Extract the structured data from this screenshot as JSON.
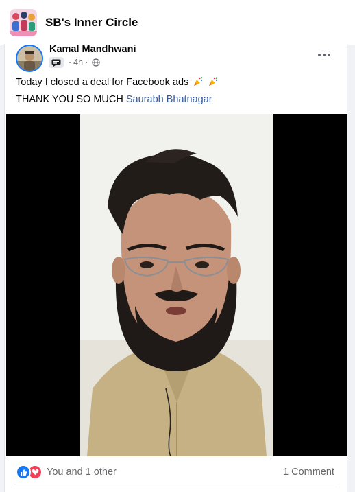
{
  "group": {
    "name": "SB's Inner Circle",
    "avatar_icon": "group-collage-avatar"
  },
  "post": {
    "author": "Kamal Mandhwani",
    "badge_icon": "member-badge-icon",
    "time": "4h",
    "separator": "·",
    "privacy_icon": "globe-icon",
    "text_line1": "Today I closed a deal for Facebook ads",
    "emojis": [
      "party-popper",
      "party-popper"
    ],
    "text_line2_prefix": "THANK YOU SO MUCH",
    "mention": "Saurabh Bhatnagar",
    "media": "video"
  },
  "engagement": {
    "reaction_icons": [
      "like-icon",
      "love-icon"
    ],
    "reactions_text": "You and 1 other",
    "comments_text": "1 Comment"
  },
  "colors": {
    "accent": "#1877f2",
    "mention": "#385898",
    "like": "#1877f2",
    "love": "#f33e58",
    "secondary_text": "#65676b"
  }
}
